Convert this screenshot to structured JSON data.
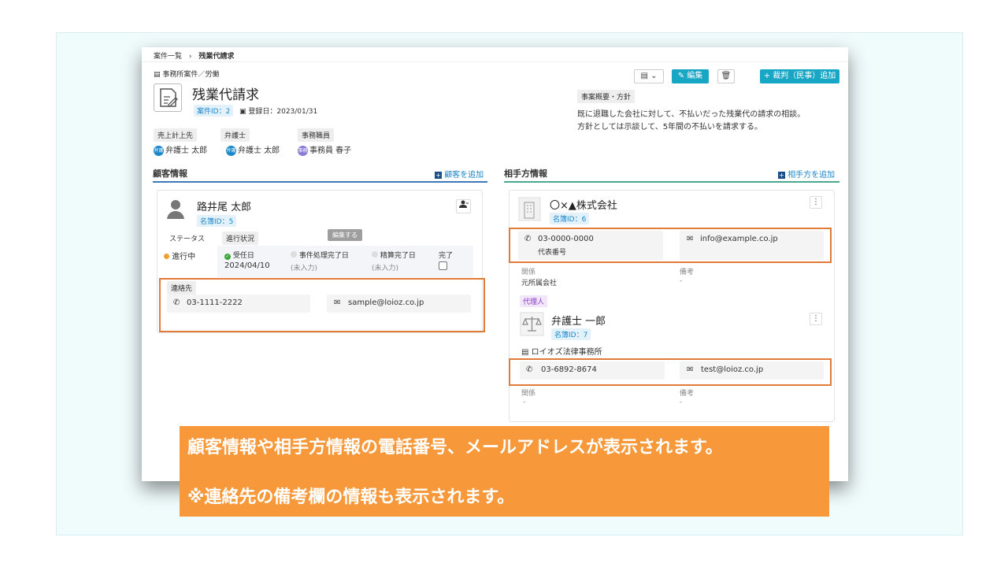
{
  "breadcrumb": {
    "parent": "案件一覧",
    "separator": "›",
    "current": "残業代請求"
  },
  "case": {
    "category": "事務所案件／労働",
    "title": "残業代請求",
    "case_id": "案件ID：2",
    "registered": "登録日：2023/01/31",
    "labels": {
      "sales": "売上計上先",
      "lawyer": "弁護士",
      "staff": "事務職員"
    },
    "sales_person": "弁護士 太郎",
    "lawyer_person": "弁護士 太郎",
    "staff_person": "事務員 春子",
    "sales_badge": "弁護",
    "lawyer_badge": "弁護",
    "staff_badge": "事務"
  },
  "toolbar": {
    "edit": "編集",
    "add_trial": "+ 裁判（民事）追加"
  },
  "summary": {
    "label": "事案概要・方針",
    "line1": "既に退職した会社に対して、不払いだった残業代の請求の相談。",
    "line2": "方針としては示談して、5年間の不払いを請求する。"
  },
  "customer_section": {
    "title": "顧客情報",
    "add": "顧客を追加"
  },
  "customer": {
    "name": "路井尾 太郎",
    "meibo_id": "名簿ID：5",
    "status_label": "ステータス",
    "progress_label": "進行状況",
    "status_value": "進行中",
    "tooltip": "編集する",
    "steps": [
      {
        "label": "受任日",
        "value": "2024/04/10"
      },
      {
        "label": "事件処理完了日",
        "value": "(未入力)"
      },
      {
        "label": "精算完了日",
        "value": "(未入力)"
      },
      {
        "label": "完了",
        "value": ""
      }
    ],
    "contact_label": "連絡先",
    "phone": "03-1111-2222",
    "email": "sample@loioz.co.jp"
  },
  "opponent_section": {
    "title": "相手方情報",
    "add": "相手方を追加"
  },
  "opponent": {
    "name": "〇×▲株式会社",
    "meibo_id": "名簿ID：6",
    "phone": "03-0000-0000",
    "phone_note": "代表番号",
    "email": "info@example.co.jp",
    "relation_label": "関係",
    "relation_value": "元所属会社",
    "note_label": "備考",
    "note_value": "-"
  },
  "agent": {
    "tag": "代理人",
    "name": "弁護士 一郎",
    "meibo_id": "名簿ID：7",
    "office": "ロイオズ法律事務所",
    "phone": "03-6892-8674",
    "email": "test@loioz.co.jp",
    "relation_label": "関係",
    "relation_value": "-",
    "note_label": "備考",
    "note_value": "-"
  },
  "banner": {
    "line1": "顧客情報や相手方情報の電話番号、メールアドレスが表示されます。",
    "line2": "※連絡先の備考欄の情報も表示されます。"
  },
  "colors": {
    "accent": "#17a6c4",
    "highlight": "#e07b39",
    "banner": "#f7993a"
  }
}
